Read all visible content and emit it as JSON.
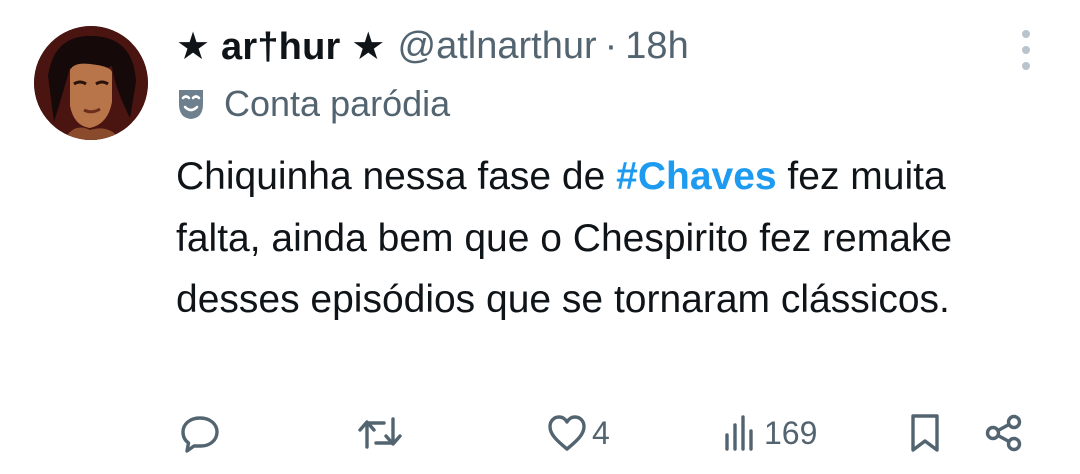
{
  "tweet": {
    "display_name": "★ ar†hur ★",
    "handle": "@atlnarthur",
    "separator": "·",
    "time": "18h",
    "label": "Conta paródia",
    "text_before": "Chiquinha nessa fase de ",
    "hashtag": "#Chaves",
    "text_after": " fez muita falta, ainda bem que o Chespirito fez remake desses episódios que se tornaram clássicos."
  },
  "actions": {
    "reply": {
      "icon": "reply-icon"
    },
    "retweet": {
      "icon": "retweet-icon"
    },
    "like": {
      "icon": "heart-icon",
      "count": "4"
    },
    "views": {
      "icon": "views-icon",
      "count": "169"
    },
    "bookmark": {
      "icon": "bookmark-icon"
    },
    "share": {
      "icon": "share-icon"
    }
  },
  "colors": {
    "text": "#0f1419",
    "secondary": "#536471",
    "accent": "#1d9bf0",
    "background": "#ffffff"
  }
}
